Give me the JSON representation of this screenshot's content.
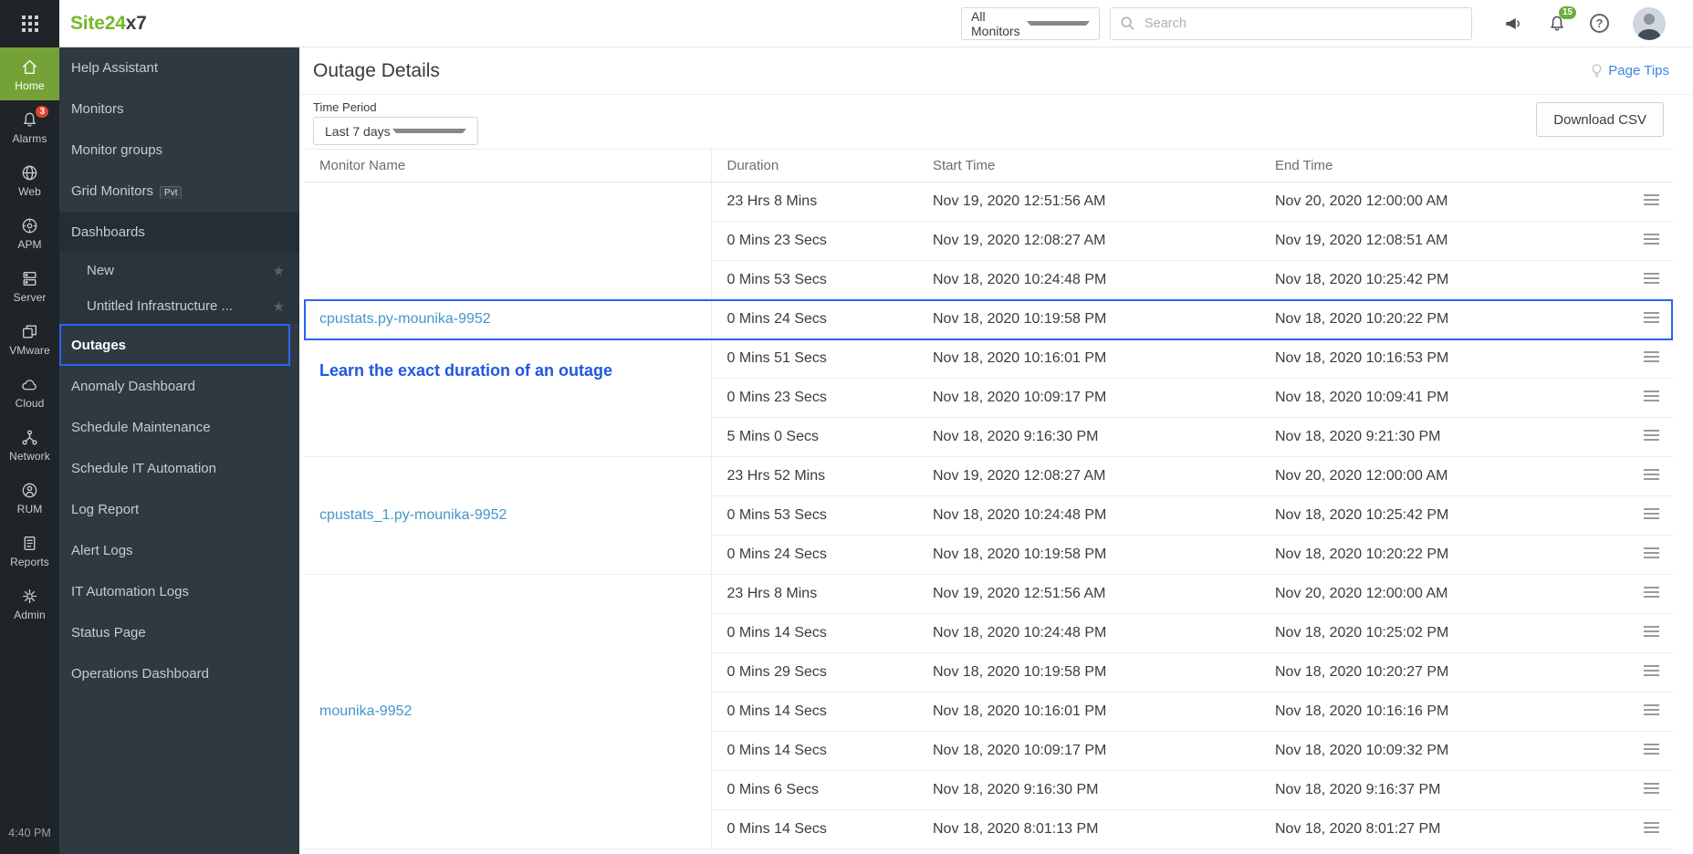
{
  "topbar": {
    "logo_green": "Site24",
    "logo_dark": "x7",
    "monitor_scope": "All Monitors",
    "search_placeholder": "Search",
    "notification_count": "15",
    "help_glyph": "?"
  },
  "rail": {
    "items": [
      {
        "label": "Home",
        "icon": "home",
        "active": true
      },
      {
        "label": "Alarms",
        "icon": "alarms",
        "badge": "3"
      },
      {
        "label": "Web",
        "icon": "web"
      },
      {
        "label": "APM",
        "icon": "apm"
      },
      {
        "label": "Server",
        "icon": "server"
      },
      {
        "label": "VMware",
        "icon": "vmware"
      },
      {
        "label": "Cloud",
        "icon": "cloud"
      },
      {
        "label": "Network",
        "icon": "network"
      },
      {
        "label": "RUM",
        "icon": "rum"
      },
      {
        "label": "Reports",
        "icon": "reports"
      },
      {
        "label": "Admin",
        "icon": "admin"
      }
    ],
    "clock": "4:40 PM"
  },
  "sidebar": {
    "items": [
      {
        "label": "Help Assistant"
      },
      {
        "label": "Monitors"
      },
      {
        "label": "Monitor groups"
      },
      {
        "label": "Grid Monitors",
        "badge": "Pvt"
      },
      {
        "label": "Dashboards",
        "section": true
      },
      {
        "label": "New",
        "sub": true,
        "star": true
      },
      {
        "label": "Untitled Infrastructure ...",
        "sub": true,
        "star": true
      },
      {
        "label": "Outages",
        "selected": true
      },
      {
        "label": "Anomaly Dashboard"
      },
      {
        "label": "Schedule Maintenance"
      },
      {
        "label": "Schedule IT Automation"
      },
      {
        "label": "Log Report"
      },
      {
        "label": "Alert Logs"
      },
      {
        "label": "IT Automation Logs"
      },
      {
        "label": "Status Page"
      },
      {
        "label": "Operations Dashboard"
      }
    ]
  },
  "page": {
    "title": "Outage Details",
    "page_tips": "Page Tips",
    "time_period_label": "Time Period",
    "time_period_value": "Last 7 days",
    "download_csv_label": "Download CSV",
    "annotation_text": "Learn the exact duration of an outage"
  },
  "table": {
    "headers": [
      "Monitor Name",
      "Duration",
      "Start Time",
      "End Time"
    ],
    "groups": [
      {
        "monitor": "cpustats.py-mounika-9952",
        "annotation": true,
        "rows": [
          {
            "duration": "23 Hrs 8 Mins",
            "start": "Nov 19, 2020 12:51:56 AM",
            "end": "Nov 20, 2020 12:00:00 AM"
          },
          {
            "duration": "0 Mins 23 Secs",
            "start": "Nov 19, 2020 12:08:27 AM",
            "end": "Nov 19, 2020 12:08:51 AM"
          },
          {
            "duration": "0 Mins 53 Secs",
            "start": "Nov 18, 2020 10:24:48 PM",
            "end": "Nov 18, 2020 10:25:42 PM"
          },
          {
            "duration": "0 Mins 24 Secs",
            "start": "Nov 18, 2020 10:19:58 PM",
            "end": "Nov 18, 2020 10:20:22 PM",
            "highlighted": true
          },
          {
            "duration": "0 Mins 51 Secs",
            "start": "Nov 18, 2020 10:16:01 PM",
            "end": "Nov 18, 2020 10:16:53 PM"
          },
          {
            "duration": "0 Mins 23 Secs",
            "start": "Nov 18, 2020 10:09:17 PM",
            "end": "Nov 18, 2020 10:09:41 PM"
          },
          {
            "duration": "5 Mins 0 Secs",
            "start": "Nov 18, 2020 9:16:30 PM",
            "end": "Nov 18, 2020 9:21:30 PM"
          }
        ]
      },
      {
        "monitor": "cpustats_1.py-mounika-9952",
        "rows": [
          {
            "duration": "23 Hrs 52 Mins",
            "start": "Nov 19, 2020 12:08:27 AM",
            "end": "Nov 20, 2020 12:00:00 AM"
          },
          {
            "duration": "0 Mins 53 Secs",
            "start": "Nov 18, 2020 10:24:48 PM",
            "end": "Nov 18, 2020 10:25:42 PM"
          },
          {
            "duration": "0 Mins 24 Secs",
            "start": "Nov 18, 2020 10:19:58 PM",
            "end": "Nov 18, 2020 10:20:22 PM"
          }
        ]
      },
      {
        "monitor": "mounika-9952",
        "rows": [
          {
            "duration": "23 Hrs 8 Mins",
            "start": "Nov 19, 2020 12:51:56 AM",
            "end": "Nov 20, 2020 12:00:00 AM"
          },
          {
            "duration": "0 Mins 14 Secs",
            "start": "Nov 18, 2020 10:24:48 PM",
            "end": "Nov 18, 2020 10:25:02 PM"
          },
          {
            "duration": "0 Mins 29 Secs",
            "start": "Nov 18, 2020 10:19:58 PM",
            "end": "Nov 18, 2020 10:20:27 PM"
          },
          {
            "duration": "0 Mins 14 Secs",
            "start": "Nov 18, 2020 10:16:01 PM",
            "end": "Nov 18, 2020 10:16:16 PM"
          },
          {
            "duration": "0 Mins 14 Secs",
            "start": "Nov 18, 2020 10:09:17 PM",
            "end": "Nov 18, 2020 10:09:32 PM"
          },
          {
            "duration": "0 Mins 6 Secs",
            "start": "Nov 18, 2020 9:16:30 PM",
            "end": "Nov 18, 2020 9:16:37 PM"
          },
          {
            "duration": "0 Mins 14 Secs",
            "start": "Nov 18, 2020 8:01:13 PM",
            "end": "Nov 18, 2020 8:01:27 PM"
          }
        ]
      }
    ]
  },
  "colors": {
    "annotation_blue": "#2865f0",
    "link_blue": "#4596c9",
    "brand_green": "#76b82a",
    "home_tile_green": "#75a237",
    "alarm_badge_red": "#e0442e",
    "notification_badge_green": "#6fae3e",
    "rail_bg": "#1e2428",
    "sidebar_bg": "#2f3941"
  }
}
